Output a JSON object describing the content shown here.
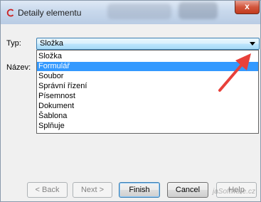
{
  "window": {
    "title": "Detaily elementu",
    "close_glyph": "x"
  },
  "form": {
    "type_label": "Typ:",
    "name_label": "Název:",
    "type_value": "Složka"
  },
  "dropdown": {
    "options": [
      "Složka",
      "Formulář",
      "Soubor",
      "Správní řízení",
      "Písemnost",
      "Dokument",
      "Šablona",
      "Splňuje"
    ],
    "selected_index": 1
  },
  "buttons": {
    "back": "< Back",
    "next": "Next >",
    "finish": "Finish",
    "cancel": "Cancel",
    "help": "Help"
  },
  "watermark": "jaSoftware.cz",
  "colors": {
    "selection": "#3399ff",
    "annotation_arrow": "#e8403a"
  },
  "icons": {
    "app": "ring-icon",
    "arrow": "red-arrow-annotation-icon"
  }
}
